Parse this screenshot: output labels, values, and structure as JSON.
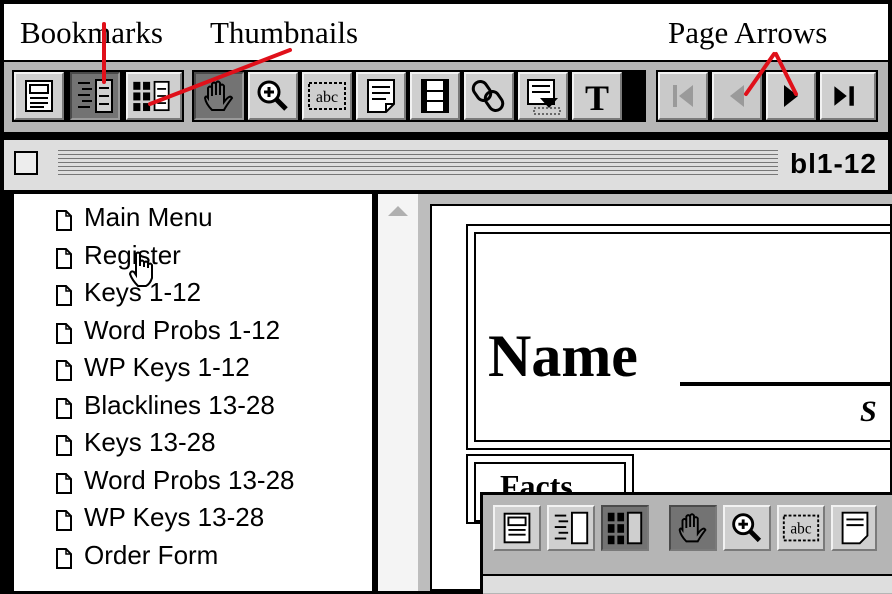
{
  "annotations": {
    "bookmarks_label": "Bookmarks",
    "thumbnails_label": "Thumbnails",
    "page_arrows_label": "Page Arrows",
    "arrow_color": "#e0101a"
  },
  "toolbar": {
    "buttons": [
      {
        "name": "page-only-view-icon",
        "state": "normal"
      },
      {
        "name": "bookmarks-view-icon",
        "state": "selected"
      },
      {
        "name": "thumbnails-view-icon",
        "state": "normal"
      },
      {
        "name": "hand-tool-icon",
        "state": "selected"
      },
      {
        "name": "zoom-tool-icon",
        "state": "normal"
      },
      {
        "name": "text-select-tool-icon",
        "state": "normal"
      },
      {
        "name": "note-tool-icon",
        "state": "normal"
      },
      {
        "name": "movie-tool-icon",
        "state": "normal"
      },
      {
        "name": "link-tool-icon",
        "state": "normal"
      },
      {
        "name": "form-tool-icon",
        "state": "normal"
      },
      {
        "name": "touchup-text-tool-icon",
        "state": "normal"
      },
      {
        "name": "first-page-icon",
        "state": "disabled"
      },
      {
        "name": "previous-page-icon",
        "state": "disabled"
      },
      {
        "name": "next-page-icon",
        "state": "normal"
      },
      {
        "name": "last-page-icon",
        "state": "normal"
      }
    ],
    "text_select_label": "abc",
    "touchup_label": "T"
  },
  "window": {
    "title": "bl1-12"
  },
  "bookmarks": [
    "Main Menu",
    "Register",
    "Keys 1-12",
    "Word Probs 1-12",
    "WP Keys 1-12",
    "Blacklines 13-28",
    "Keys 13-28",
    "Word Probs 13-28",
    "WP Keys 13-28",
    "Order Form"
  ],
  "document": {
    "name_label": "Name",
    "small_s": "S",
    "facts_label": "Facts"
  },
  "nested_toolbar": {
    "text_select_label": "abc"
  }
}
